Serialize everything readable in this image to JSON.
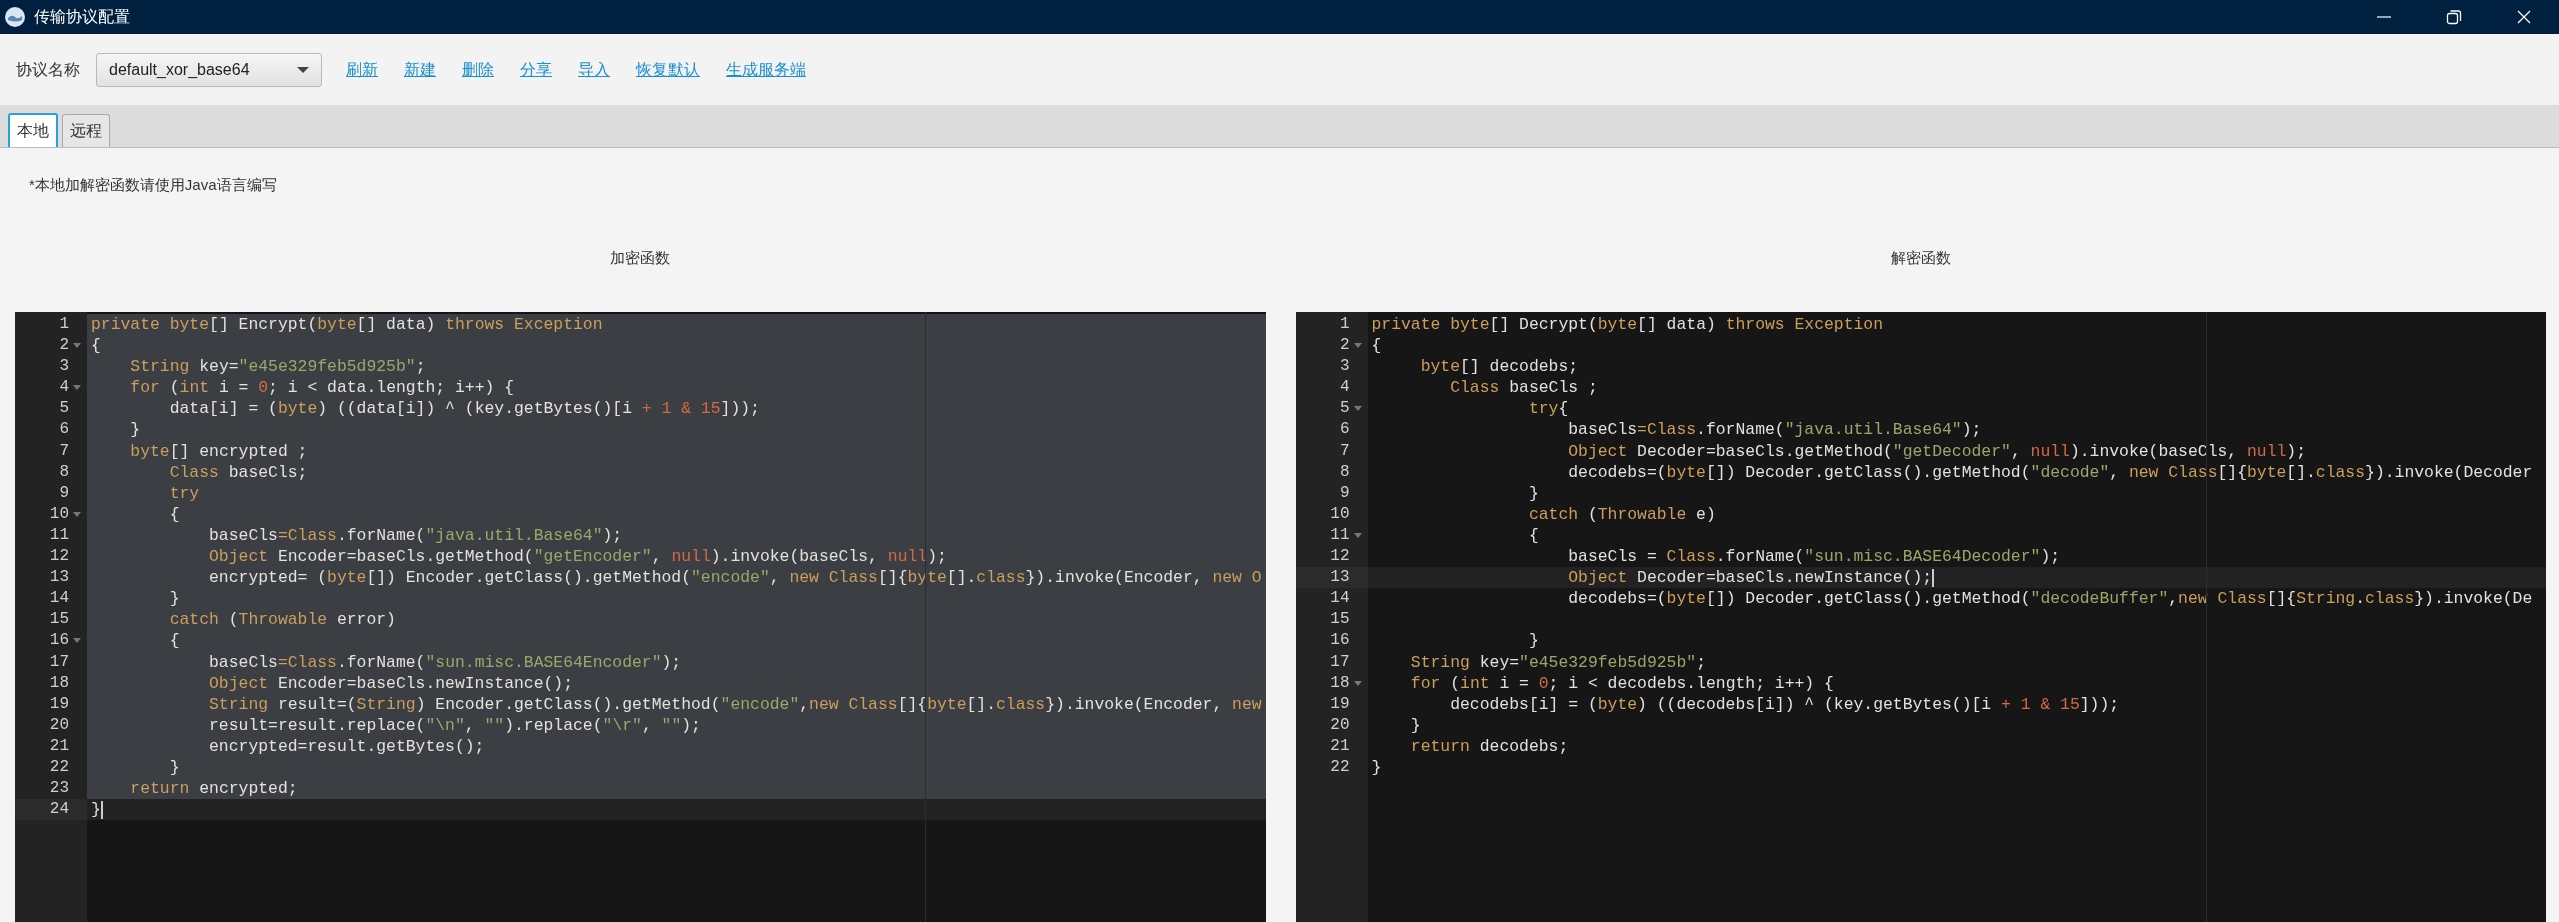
{
  "window": {
    "title": "传输协议配置"
  },
  "toolbar": {
    "label": "协议名称",
    "protocol": {
      "value": "default_xor_base64"
    },
    "links": [
      "刷新",
      "新建",
      "删除",
      "分享",
      "导入",
      "恢复默认",
      "生成服务端"
    ]
  },
  "tabs": [
    {
      "label": "本地",
      "selected": true
    },
    {
      "label": "远程",
      "selected": false
    }
  ],
  "note": "*本地加解密函数请使用Java语言编写",
  "editors": [
    {
      "heading": "加密函数",
      "lines": [
        {
          "n": "1",
          "fold": false,
          "selected": true,
          "active": false,
          "seg": [
            {
              "kind": "keyword",
              "text": "private byte"
            },
            {
              "kind": "plain",
              "text": "[] Encrypt("
            },
            {
              "kind": "keyword",
              "text": "byte"
            },
            {
              "kind": "plain",
              "text": "[] data) "
            },
            {
              "kind": "keyword",
              "text": "throws Exception"
            }
          ]
        },
        {
          "n": "2",
          "fold": true,
          "selected": true,
          "active": false,
          "seg": [
            {
              "kind": "plain",
              "text": "{"
            }
          ]
        },
        {
          "n": "3",
          "fold": false,
          "selected": true,
          "active": false,
          "seg": [
            {
              "kind": "keyword",
              "text": "    String"
            },
            {
              "kind": "plain",
              "text": " key="
            },
            {
              "kind": "string",
              "text": "\"e45e329feb5d925b\""
            },
            {
              "kind": "plain",
              "text": ";"
            }
          ]
        },
        {
          "n": "4",
          "fold": true,
          "selected": true,
          "active": false,
          "seg": [
            {
              "kind": "keyword",
              "text": "    for"
            },
            {
              "kind": "plain",
              "text": " ("
            },
            {
              "kind": "keyword",
              "text": "int"
            },
            {
              "kind": "plain",
              "text": " i = "
            },
            {
              "kind": "number",
              "text": "0"
            },
            {
              "kind": "plain",
              "text": "; i < data.length; i++) {"
            }
          ]
        },
        {
          "n": "5",
          "fold": false,
          "selected": true,
          "active": false,
          "seg": [
            {
              "kind": "plain",
              "text": "        data[i] = ("
            },
            {
              "kind": "keyword",
              "text": "byte"
            },
            {
              "kind": "plain",
              "text": ") ((data[i]) ^ (key.getBytes()[i "
            },
            {
              "kind": "number",
              "text": "+ 1 & 15"
            },
            {
              "kind": "plain",
              "text": "]));"
            }
          ]
        },
        {
          "n": "6",
          "fold": false,
          "selected": true,
          "active": false,
          "seg": [
            {
              "kind": "plain",
              "text": "    }"
            }
          ]
        },
        {
          "n": "7",
          "fold": false,
          "selected": true,
          "active": false,
          "seg": [
            {
              "kind": "keyword",
              "text": "    byte"
            },
            {
              "kind": "plain",
              "text": "[] encrypted ;"
            }
          ]
        },
        {
          "n": "8",
          "fold": false,
          "selected": true,
          "active": false,
          "seg": [
            {
              "kind": "keyword",
              "text": "        Class"
            },
            {
              "kind": "plain",
              "text": " baseCls;"
            }
          ]
        },
        {
          "n": "9",
          "fold": false,
          "selected": true,
          "active": false,
          "seg": [
            {
              "kind": "keyword",
              "text": "        try"
            }
          ]
        },
        {
          "n": "10",
          "fold": true,
          "selected": true,
          "active": false,
          "seg": [
            {
              "kind": "plain",
              "text": "        {"
            }
          ]
        },
        {
          "n": "11",
          "fold": false,
          "selected": true,
          "active": false,
          "seg": [
            {
              "kind": "plain",
              "text": "            baseCls"
            },
            {
              "kind": "keyword",
              "text": "=Class"
            },
            {
              "kind": "plain",
              "text": ".forName("
            },
            {
              "kind": "string",
              "text": "\"java.util.Base64\""
            },
            {
              "kind": "plain",
              "text": ");"
            }
          ]
        },
        {
          "n": "12",
          "fold": false,
          "selected": true,
          "active": false,
          "seg": [
            {
              "kind": "keyword",
              "text": "            Object"
            },
            {
              "kind": "plain",
              "text": " Encoder=baseCls.getMethod("
            },
            {
              "kind": "string",
              "text": "\"getEncoder\""
            },
            {
              "kind": "plain",
              "text": ", "
            },
            {
              "kind": "number",
              "text": "null"
            },
            {
              "kind": "plain",
              "text": ").invoke(baseCls, "
            },
            {
              "kind": "number",
              "text": "null"
            },
            {
              "kind": "plain",
              "text": ");"
            }
          ]
        },
        {
          "n": "13",
          "fold": false,
          "selected": true,
          "active": false,
          "seg": [
            {
              "kind": "plain",
              "text": "            encrypted= ("
            },
            {
              "kind": "keyword",
              "text": "byte"
            },
            {
              "kind": "plain",
              "text": "[]) Encoder.getClass().getMethod("
            },
            {
              "kind": "string",
              "text": "\"encode\""
            },
            {
              "kind": "plain",
              "text": ", "
            },
            {
              "kind": "keyword",
              "text": "new Class"
            },
            {
              "kind": "plain",
              "text": "[]{"
            },
            {
              "kind": "keyword",
              "text": "byte"
            },
            {
              "kind": "plain",
              "text": "[]."
            },
            {
              "kind": "keyword",
              "text": "class"
            },
            {
              "kind": "plain",
              "text": "}).invoke(Encoder, "
            },
            {
              "kind": "keyword",
              "text": "new O"
            }
          ]
        },
        {
          "n": "14",
          "fold": false,
          "selected": true,
          "active": false,
          "seg": [
            {
              "kind": "plain",
              "text": "        }"
            }
          ]
        },
        {
          "n": "15",
          "fold": false,
          "selected": true,
          "active": false,
          "seg": [
            {
              "kind": "keyword",
              "text": "        catch"
            },
            {
              "kind": "plain",
              "text": " ("
            },
            {
              "kind": "keyword",
              "text": "Throwable"
            },
            {
              "kind": "plain",
              "text": " error)"
            }
          ]
        },
        {
          "n": "16",
          "fold": true,
          "selected": true,
          "active": false,
          "seg": [
            {
              "kind": "plain",
              "text": "        {"
            }
          ]
        },
        {
          "n": "17",
          "fold": false,
          "selected": true,
          "active": false,
          "seg": [
            {
              "kind": "plain",
              "text": "            baseCls"
            },
            {
              "kind": "keyword",
              "text": "=Class"
            },
            {
              "kind": "plain",
              "text": ".forName("
            },
            {
              "kind": "string",
              "text": "\"sun.misc.BASE64Encoder\""
            },
            {
              "kind": "plain",
              "text": ");"
            }
          ]
        },
        {
          "n": "18",
          "fold": false,
          "selected": true,
          "active": false,
          "seg": [
            {
              "kind": "keyword",
              "text": "            Object"
            },
            {
              "kind": "plain",
              "text": " Encoder=baseCls.newInstance();"
            }
          ]
        },
        {
          "n": "19",
          "fold": false,
          "selected": true,
          "active": false,
          "seg": [
            {
              "kind": "keyword",
              "text": "            String"
            },
            {
              "kind": "plain",
              "text": " result=("
            },
            {
              "kind": "keyword",
              "text": "String"
            },
            {
              "kind": "plain",
              "text": ") Encoder.getClass().getMethod("
            },
            {
              "kind": "string",
              "text": "\"encode\""
            },
            {
              "kind": "plain",
              "text": ","
            },
            {
              "kind": "keyword",
              "text": "new Class"
            },
            {
              "kind": "plain",
              "text": "[]{"
            },
            {
              "kind": "keyword",
              "text": "byte"
            },
            {
              "kind": "plain",
              "text": "[]."
            },
            {
              "kind": "keyword",
              "text": "class"
            },
            {
              "kind": "plain",
              "text": "}).invoke(Encoder, "
            },
            {
              "kind": "keyword",
              "text": "new"
            }
          ]
        },
        {
          "n": "20",
          "fold": false,
          "selected": true,
          "active": false,
          "seg": [
            {
              "kind": "plain",
              "text": "            result=result.replace("
            },
            {
              "kind": "string",
              "text": "\"\\n\""
            },
            {
              "kind": "plain",
              "text": ", "
            },
            {
              "kind": "string",
              "text": "\"\""
            },
            {
              "kind": "plain",
              "text": ").replace("
            },
            {
              "kind": "string",
              "text": "\"\\r\""
            },
            {
              "kind": "plain",
              "text": ", "
            },
            {
              "kind": "string",
              "text": "\"\""
            },
            {
              "kind": "plain",
              "text": ");"
            }
          ]
        },
        {
          "n": "21",
          "fold": false,
          "selected": true,
          "active": false,
          "seg": [
            {
              "kind": "plain",
              "text": "            encrypted=result.getBytes();"
            }
          ]
        },
        {
          "n": "22",
          "fold": false,
          "selected": true,
          "active": false,
          "seg": [
            {
              "kind": "plain",
              "text": "        }"
            }
          ]
        },
        {
          "n": "23",
          "fold": false,
          "selected": true,
          "active": false,
          "seg": [
            {
              "kind": "keyword",
              "text": "    return"
            },
            {
              "kind": "plain",
              "text": " encrypted;"
            }
          ]
        },
        {
          "n": "24",
          "fold": false,
          "selected": false,
          "active": true,
          "seg": [
            {
              "kind": "plain",
              "text": "}"
            }
          ]
        }
      ]
    },
    {
      "heading": "解密函数",
      "lines": [
        {
          "n": "1",
          "fold": false,
          "selected": false,
          "active": false,
          "seg": [
            {
              "kind": "keyword",
              "text": "private byte"
            },
            {
              "kind": "plain",
              "text": "[] Decrypt("
            },
            {
              "kind": "keyword",
              "text": "byte"
            },
            {
              "kind": "plain",
              "text": "[] data) "
            },
            {
              "kind": "keyword",
              "text": "throws Exception"
            }
          ]
        },
        {
          "n": "2",
          "fold": true,
          "selected": false,
          "active": false,
          "seg": [
            {
              "kind": "plain",
              "text": "{"
            }
          ]
        },
        {
          "n": "3",
          "fold": false,
          "selected": false,
          "active": false,
          "seg": [
            {
              "kind": "keyword",
              "text": "     byte"
            },
            {
              "kind": "plain",
              "text": "[] decodebs;"
            }
          ]
        },
        {
          "n": "4",
          "fold": false,
          "selected": false,
          "active": false,
          "seg": [
            {
              "kind": "keyword",
              "text": "        Class"
            },
            {
              "kind": "plain",
              "text": " baseCls ;"
            }
          ]
        },
        {
          "n": "5",
          "fold": true,
          "selected": false,
          "active": false,
          "seg": [
            {
              "kind": "keyword",
              "text": "                try"
            },
            {
              "kind": "plain",
              "text": "{"
            }
          ]
        },
        {
          "n": "6",
          "fold": false,
          "selected": false,
          "active": false,
          "seg": [
            {
              "kind": "plain",
              "text": "                    baseCls"
            },
            {
              "kind": "keyword",
              "text": "=Class"
            },
            {
              "kind": "plain",
              "text": ".forName("
            },
            {
              "kind": "string",
              "text": "\"java.util.Base64\""
            },
            {
              "kind": "plain",
              "text": ");"
            }
          ]
        },
        {
          "n": "7",
          "fold": false,
          "selected": false,
          "active": false,
          "seg": [
            {
              "kind": "keyword",
              "text": "                    Object"
            },
            {
              "kind": "plain",
              "text": " Decoder=baseCls.getMethod("
            },
            {
              "kind": "string",
              "text": "\"getDecoder\""
            },
            {
              "kind": "plain",
              "text": ", "
            },
            {
              "kind": "number",
              "text": "null"
            },
            {
              "kind": "plain",
              "text": ").invoke(baseCls, "
            },
            {
              "kind": "number",
              "text": "null"
            },
            {
              "kind": "plain",
              "text": ");"
            }
          ]
        },
        {
          "n": "8",
          "fold": false,
          "selected": false,
          "active": false,
          "seg": [
            {
              "kind": "plain",
              "text": "                    decodebs=("
            },
            {
              "kind": "keyword",
              "text": "byte"
            },
            {
              "kind": "plain",
              "text": "[]) Decoder.getClass().getMethod("
            },
            {
              "kind": "string",
              "text": "\"decode\""
            },
            {
              "kind": "plain",
              "text": ", "
            },
            {
              "kind": "keyword",
              "text": "new Class"
            },
            {
              "kind": "plain",
              "text": "[]{"
            },
            {
              "kind": "keyword",
              "text": "byte"
            },
            {
              "kind": "plain",
              "text": "[]."
            },
            {
              "kind": "keyword",
              "text": "class"
            },
            {
              "kind": "plain",
              "text": "}).invoke(Decoder"
            }
          ]
        },
        {
          "n": "9",
          "fold": false,
          "selected": false,
          "active": false,
          "seg": [
            {
              "kind": "plain",
              "text": "                }"
            }
          ]
        },
        {
          "n": "10",
          "fold": false,
          "selected": false,
          "active": false,
          "seg": [
            {
              "kind": "keyword",
              "text": "                catch"
            },
            {
              "kind": "plain",
              "text": " ("
            },
            {
              "kind": "keyword",
              "text": "Throwable"
            },
            {
              "kind": "plain",
              "text": " e)"
            }
          ]
        },
        {
          "n": "11",
          "fold": true,
          "selected": false,
          "active": false,
          "seg": [
            {
              "kind": "plain",
              "text": "                {"
            }
          ]
        },
        {
          "n": "12",
          "fold": false,
          "selected": false,
          "active": false,
          "seg": [
            {
              "kind": "plain",
              "text": "                    baseCls = "
            },
            {
              "kind": "keyword",
              "text": "Class"
            },
            {
              "kind": "plain",
              "text": ".forName("
            },
            {
              "kind": "string",
              "text": "\"sun.misc.BASE64Decoder\""
            },
            {
              "kind": "plain",
              "text": ");"
            }
          ]
        },
        {
          "n": "13",
          "fold": false,
          "selected": false,
          "active": true,
          "seg": [
            {
              "kind": "keyword",
              "text": "                    Object"
            },
            {
              "kind": "plain",
              "text": " Decoder=baseCls.newInstance();"
            }
          ]
        },
        {
          "n": "14",
          "fold": false,
          "selected": false,
          "active": false,
          "seg": [
            {
              "kind": "plain",
              "text": "                    decodebs=("
            },
            {
              "kind": "keyword",
              "text": "byte"
            },
            {
              "kind": "plain",
              "text": "[]) Decoder.getClass().getMethod("
            },
            {
              "kind": "string",
              "text": "\"decodeBuffer\""
            },
            {
              "kind": "plain",
              "text": ","
            },
            {
              "kind": "keyword",
              "text": "new Class"
            },
            {
              "kind": "plain",
              "text": "[]{"
            },
            {
              "kind": "keyword",
              "text": "String"
            },
            {
              "kind": "plain",
              "text": "."
            },
            {
              "kind": "keyword",
              "text": "class"
            },
            {
              "kind": "plain",
              "text": "}).invoke(De"
            }
          ]
        },
        {
          "n": "15",
          "fold": false,
          "selected": false,
          "active": false
        },
        {
          "n": "16",
          "fold": false,
          "selected": false,
          "active": false,
          "seg": [
            {
              "kind": "plain",
              "text": "                }"
            }
          ]
        },
        {
          "n": "17",
          "fold": false,
          "selected": false,
          "active": false,
          "seg": [
            {
              "kind": "keyword",
              "text": "    String"
            },
            {
              "kind": "plain",
              "text": " key="
            },
            {
              "kind": "string",
              "text": "\"e45e329feb5d925b\""
            },
            {
              "kind": "plain",
              "text": ";"
            }
          ]
        },
        {
          "n": "18",
          "fold": true,
          "selected": false,
          "active": false,
          "seg": [
            {
              "kind": "keyword",
              "text": "    for"
            },
            {
              "kind": "plain",
              "text": " ("
            },
            {
              "kind": "keyword",
              "text": "int"
            },
            {
              "kind": "plain",
              "text": " i = "
            },
            {
              "kind": "number",
              "text": "0"
            },
            {
              "kind": "plain",
              "text": "; i < decodebs.length; i++) {"
            }
          ]
        },
        {
          "n": "19",
          "fold": false,
          "selected": false,
          "active": false,
          "seg": [
            {
              "kind": "plain",
              "text": "        decodebs[i] = ("
            },
            {
              "kind": "keyword",
              "text": "byte"
            },
            {
              "kind": "plain",
              "text": ") ((decodebs[i]) ^ (key.getBytes()[i "
            },
            {
              "kind": "number",
              "text": "+ 1 & 15"
            },
            {
              "kind": "plain",
              "text": "]));"
            }
          ]
        },
        {
          "n": "20",
          "fold": false,
          "selected": false,
          "active": false,
          "seg": [
            {
              "kind": "plain",
              "text": "    }"
            }
          ]
        },
        {
          "n": "21",
          "fold": false,
          "selected": false,
          "active": false,
          "seg": [
            {
              "kind": "keyword",
              "text": "    return"
            },
            {
              "kind": "plain",
              "text": " decodebs;"
            }
          ]
        },
        {
          "n": "22",
          "fold": false,
          "selected": false,
          "active": false,
          "seg": [
            {
              "kind": "plain",
              "text": "}"
            }
          ]
        }
      ]
    }
  ]
}
